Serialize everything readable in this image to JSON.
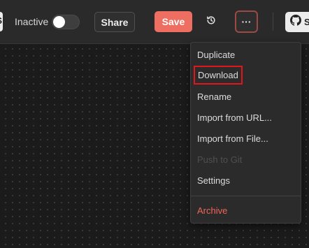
{
  "header": {
    "left_stub_label": "S",
    "status_label": "Inactive",
    "toggle_state": "off",
    "share_label": "Share",
    "save_label": "Save",
    "history_icon": "history-icon",
    "more_label": "···",
    "github_label": "S",
    "github_icon": "github-icon"
  },
  "menu": {
    "items": [
      {
        "label": "Duplicate",
        "state": "normal"
      },
      {
        "label": "Download",
        "state": "highlighted"
      },
      {
        "label": "Rename",
        "state": "normal"
      },
      {
        "label": "Import from URL...",
        "state": "normal"
      },
      {
        "label": "Import from File...",
        "state": "normal"
      },
      {
        "label": "Push to Git",
        "state": "disabled"
      },
      {
        "label": "Settings",
        "state": "normal"
      },
      {
        "label": "Archive",
        "state": "danger"
      }
    ]
  },
  "colors": {
    "save_button": "#ee6e61",
    "archive_text": "#f0655a",
    "highlight_border": "#e0161b",
    "canvas_bg": "#1b1b1b",
    "header_bg": "#2a2a2a"
  }
}
